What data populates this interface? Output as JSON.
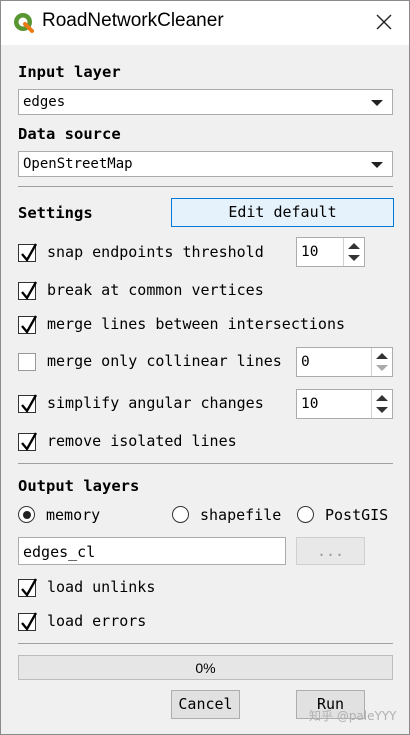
{
  "window": {
    "title": "RoadNetworkCleaner",
    "logo_icon": "qgis-logo-icon",
    "close_icon": "close-icon"
  },
  "input": {
    "layer_label": "Input layer",
    "layer_value": "edges",
    "source_label": "Data source",
    "source_value": "OpenStreetMap"
  },
  "settings": {
    "label": "Settings",
    "edit_default": "Edit default",
    "options": [
      {
        "label": "snap endpoints threshold",
        "checked": true,
        "spin": "10"
      },
      {
        "label": "break at common vertices",
        "checked": true
      },
      {
        "label": "merge lines between intersections",
        "checked": true
      },
      {
        "label": "merge only collinear lines",
        "checked": false,
        "spin": "0"
      },
      {
        "label": "simplify angular changes",
        "checked": true,
        "spin": "10"
      },
      {
        "label": "remove isolated lines",
        "checked": true
      }
    ]
  },
  "output": {
    "label": "Output layers",
    "formats": [
      {
        "label": "memory",
        "selected": true
      },
      {
        "label": "shapefile",
        "selected": false
      },
      {
        "label": "PostGIS",
        "selected": false
      }
    ],
    "name_value": "edges_cl",
    "browse_label": "...",
    "load_unlinks": "load unlinks",
    "load_errors": "load errors"
  },
  "progress": {
    "value": 0,
    "text": "0%"
  },
  "buttons": {
    "cancel": "Cancel",
    "run": "Run"
  },
  "watermark": "知乎 @paleYYY",
  "colors": {
    "accent": "#0078d7",
    "window_bg": "#f0f0f0",
    "progress_fill": "#06b025"
  }
}
